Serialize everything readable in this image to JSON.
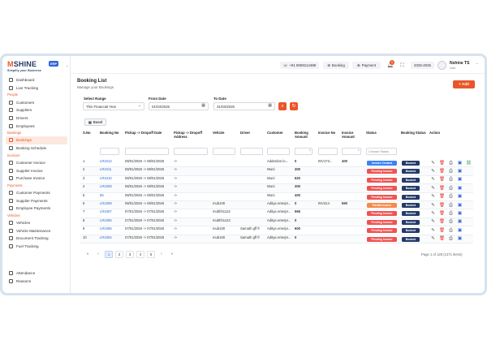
{
  "sidebar": {
    "logo": {
      "brand_a": "M",
      "brand_b": "SHINE",
      "badge": "ERP",
      "tagline": "Simplify your Business"
    },
    "groups": [
      {
        "section": "",
        "items": [
          {
            "label": "Dashboard"
          },
          {
            "label": "Live Tracking"
          }
        ]
      },
      {
        "section": "People",
        "items": [
          {
            "label": "Customers"
          },
          {
            "label": "Suppliers"
          },
          {
            "label": "Drivers"
          },
          {
            "label": "Employees"
          }
        ]
      },
      {
        "section": "Bookings",
        "items": [
          {
            "label": "Bookings"
          },
          {
            "label": "Booking Schedule"
          }
        ]
      },
      {
        "section": "Invoices",
        "items": [
          {
            "label": "Customer Invoice"
          },
          {
            "label": "Supplier Invoice"
          },
          {
            "label": "Purchase Invoice"
          }
        ]
      },
      {
        "section": "Payments",
        "items": [
          {
            "label": "Customer Payments"
          },
          {
            "label": "Supplier Payments"
          },
          {
            "label": "Employee Payments"
          }
        ]
      },
      {
        "section": "Vehicles",
        "items": [
          {
            "label": "Vehicles"
          },
          {
            "label": "Vehicle Maintenance"
          },
          {
            "label": "Document Tracking"
          },
          {
            "label": "Fuel Tracking"
          }
        ]
      }
    ],
    "bottom": [
      {
        "label": "Attendance"
      },
      {
        "label": "Reasons"
      }
    ]
  },
  "header": {
    "phone": "+91 8008114488",
    "booking_btn": "Booking",
    "payment_btn": "Payment",
    "notif_count": "1",
    "year": "2025-2026",
    "user_name": "Nshine TS",
    "user_role": "User"
  },
  "page": {
    "title": "Booking List",
    "subtitle": "Manage your Bookings",
    "add_label": "+ Add",
    "filters": {
      "range_label": "Select Range",
      "range_value": "This Financial Year",
      "from_label": "From Date",
      "from_value": "01/04/2025",
      "to_label": "To Date",
      "to_value": "31/03/2026"
    },
    "excel_label": "Excel"
  },
  "table": {
    "columns": [
      "S.No",
      "Booking No",
      "Pickup -> Dropoff Date",
      "Pickup -> Dropoff Address",
      "Vehicle",
      "Driver",
      "Customer",
      "Booking Amount",
      "Invoice No",
      "Invoice Amount",
      "Status",
      "Booking Status",
      "Action"
    ],
    "status_filter_placeholder": "Choose Status",
    "rows": [
      {
        "sno": "1",
        "booking_no": "LR1012",
        "dates": "08/01/2026 -> 08/01/2026",
        "address": "->",
        "vehicle": "",
        "driver": "",
        "customer": "Adderdon lo...",
        "amount": "0",
        "invoice_no": "INV173...",
        "invoice_amount": "400",
        "status": "Invoice Created",
        "status_color": "#3b82f6",
        "booking_status": "Booked"
      },
      {
        "sno": "2",
        "booking_no": "LR1011",
        "dates": "08/01/2026 -> 08/01/2026",
        "address": "->",
        "vehicle": "",
        "driver": "",
        "customer": "Wuni",
        "amount": "300",
        "invoice_no": "",
        "invoice_amount": "",
        "status": "Pending Invoice",
        "status_color": "#ef5350",
        "booking_status": "Booked"
      },
      {
        "sno": "3",
        "booking_no": "LR1010",
        "dates": "08/01/2026 -> 08/01/2026",
        "address": "->",
        "vehicle": "",
        "driver": "",
        "customer": "Wuni",
        "amount": "620",
        "invoice_no": "",
        "invoice_amount": "",
        "status": "Pending Invoice",
        "status_color": "#ef5350",
        "booking_status": "Booked"
      },
      {
        "sno": "4",
        "booking_no": "LR1009",
        "dates": "08/01/2026 -> 08/01/2026",
        "address": "->",
        "vehicle": "",
        "driver": "",
        "customer": "Wuni",
        "amount": "300",
        "invoice_no": "",
        "invoice_amount": "",
        "status": "Pending Invoice",
        "status_color": "#ef5350",
        "booking_status": "Booked"
      },
      {
        "sno": "5",
        "booking_no": "55",
        "dates": "08/01/2026 -> 08/01/2026",
        "address": "->",
        "vehicle": "",
        "driver": "",
        "customer": "Wuni",
        "amount": "400",
        "invoice_no": "",
        "invoice_amount": "",
        "status": "Pending Invoice",
        "status_color": "#ef5350",
        "booking_status": "Booked"
      },
      {
        "sno": "6",
        "booking_no": "LR1008",
        "dates": "08/01/2026 -> 08/01/2026",
        "address": "->",
        "vehicle": "mub100",
        "driver": "",
        "customer": "Aditya enterpr...",
        "amount": "0",
        "invoice_no": "INV314",
        "invoice_amount": "690",
        "status": "Partial Invoice",
        "status_color": "#f7894a",
        "booking_status": "Booked"
      },
      {
        "sno": "7",
        "booking_no": "LR1067",
        "dates": "07/01/2026 -> 07/01/2026",
        "address": "->",
        "vehicle": "mubhh1122",
        "driver": "",
        "customer": "Aditya enterpr...",
        "amount": "565",
        "invoice_no": "",
        "invoice_amount": "",
        "status": "Pending Invoice",
        "status_color": "#ef5350",
        "booking_status": "Booked"
      },
      {
        "sno": "8",
        "booking_no": "LR1066",
        "dates": "07/01/2026 -> 07/01/2026",
        "address": "->",
        "vehicle": "mubhh1122",
        "driver": "",
        "customer": "Aditya enterpr...",
        "amount": "0",
        "invoice_no": "",
        "invoice_amount": "",
        "status": "Pending Invoice",
        "status_color": "#ef5350",
        "booking_status": "Booked"
      },
      {
        "sno": "9",
        "booking_no": "LR1065",
        "dates": "07/01/2026 -> 07/01/2026",
        "address": "->",
        "vehicle": "mub100",
        "driver": "Samath gff fr",
        "customer": "Aditya enterpr...",
        "amount": "600",
        "invoice_no": "",
        "invoice_amount": "",
        "status": "Pending Invoice",
        "status_color": "#ef5350",
        "booking_status": "Booked"
      },
      {
        "sno": "10",
        "booking_no": "LR1064",
        "dates": "07/01/2026 -> 07/01/2026",
        "address": "->",
        "vehicle": "mub100",
        "driver": "Samath gff fr",
        "customer": "Aditya enterpr...",
        "amount": "0",
        "invoice_no": "",
        "invoice_amount": "",
        "status": "Pending Invoice",
        "status_color": "#ef5350",
        "booking_status": "Booked"
      }
    ]
  },
  "pagination": {
    "pages": [
      "1",
      "2",
      "3",
      "4",
      "5"
    ],
    "current": "1",
    "info": "Page 1 of 128 (1271 items)"
  },
  "colors": {
    "accent": "#e8572a",
    "navy": "#243a6b",
    "link": "#2d66d6"
  }
}
